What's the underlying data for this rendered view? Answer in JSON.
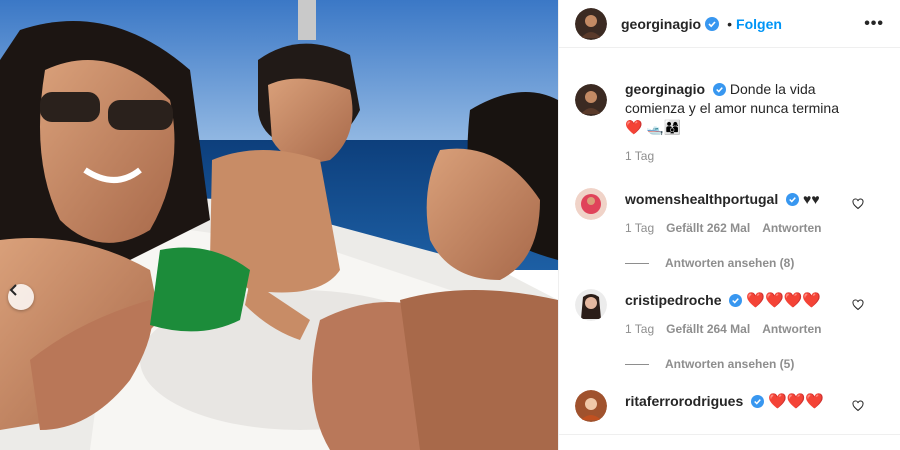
{
  "post": {
    "author": "georginagio",
    "dot": "•",
    "follow_label": "Folgen",
    "more_label": "•••"
  },
  "caption": {
    "username": "georginagio",
    "text": "Donde la vida comienza y el amor nunca termina ❤️ 🛥️👨‍👩‍👦",
    "time": "1 Tag"
  },
  "comments": [
    {
      "username": "womenshealthportugal",
      "text": "♥♥",
      "time": "1 Tag",
      "likes": "Gefällt 262 Mal",
      "reply": "Antworten",
      "view_replies": "Antworten ansehen (8)"
    },
    {
      "username": "cristipedroche",
      "text": "❤️❤️❤️❤️",
      "time": "1 Tag",
      "likes": "Gefällt 264 Mal",
      "reply": "Antworten",
      "view_replies": "Antworten ansehen (5)"
    },
    {
      "username": "ritaferrorodrigues",
      "text": "❤️❤️❤️"
    }
  ],
  "colors": {
    "accent": "#0095f6",
    "verified": "#3897f0",
    "muted": "#8e8e8e"
  },
  "icons": [
    "chevron-left-icon",
    "more-icon",
    "verified-icon",
    "heart-outline-icon"
  ]
}
